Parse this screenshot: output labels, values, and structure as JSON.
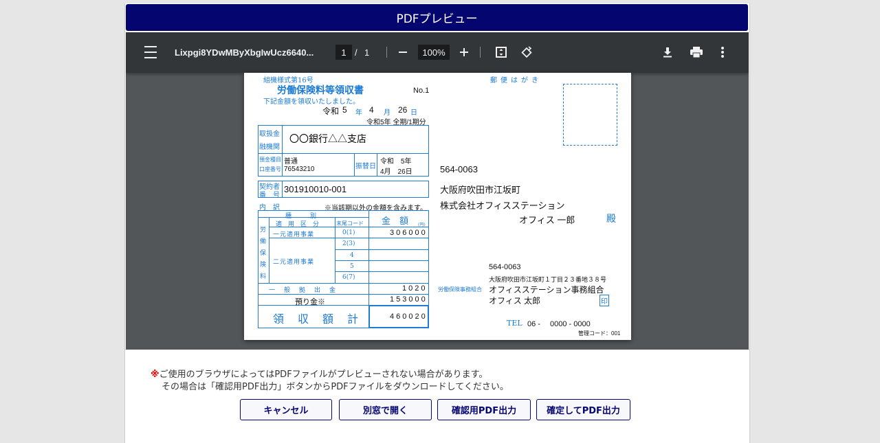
{
  "dialog": {
    "title": "PDFプレビュー"
  },
  "viewer": {
    "file_name": "Lixpgi8YDwMByXbgIwUcz6640...",
    "current_page": "1",
    "page_separator": "/",
    "total_pages": "1",
    "zoom": "100%",
    "icons": [
      "menu-icon",
      "zoom-out-icon",
      "zoom-in-icon",
      "fit-page-icon",
      "rotate-icon",
      "download-icon",
      "print-icon",
      "more-vert-icon"
    ]
  },
  "document": {
    "form_number": "組機様式第16号",
    "title": "労働保険料等領収書",
    "no": "No.1",
    "received_text": "下記金額を領収いたしました。",
    "date": {
      "era": "令和",
      "year": "5",
      "year_unit": "年",
      "month": "4",
      "month_unit": "月",
      "day": "26",
      "day_unit": "日"
    },
    "period": "令和5年 全期/1期分",
    "bank_label_1": "取扱金",
    "bank_label_2": "融機関",
    "bank_name": "〇〇銀行△△支店",
    "account_label_1": "預金種目",
    "account_label_2": "口座番号",
    "account_type": "普通",
    "account_number": "76543210",
    "transfer_label": "振替日",
    "transfer_date_1": "令和　5年",
    "transfer_date_2": "4月　26日",
    "contract_label_1": "契約者",
    "contract_label_2": "番　号",
    "contract_number": "301910010-001",
    "breakdown_label": "内　訳",
    "breakdown_note": "※当該期以外の金額を含みます。",
    "table": {
      "kind_header": "種　　　別",
      "category_header": "適　用　区　分",
      "code_header": "末尾コード",
      "amount_header": "金　額",
      "yen": "(円)",
      "side_label": [
        "労",
        "働",
        "保",
        "険",
        "料"
      ],
      "rows": [
        {
          "category": "一元適用事業",
          "code": "0(1)",
          "amount": "306000"
        },
        {
          "category": "",
          "code": "2(3)",
          "amount": ""
        },
        {
          "category": "二元適用事業",
          "code": "4",
          "amount": ""
        },
        {
          "category": "",
          "code": "5",
          "amount": ""
        },
        {
          "category": "",
          "code": "6(7)",
          "amount": ""
        }
      ],
      "general_label": "一　般　拠　出　金",
      "general_amount": "1020",
      "deposit_label": "預り金※",
      "deposit_amount": "153000",
      "total_label": "領　収　額　計",
      "total_amount": "460020"
    },
    "postcard_label": "郵便はがき",
    "recipient": {
      "zip": "564-0063",
      "address": "大阪府吹田市江坂町",
      "company": "株式会社オフィスステーション",
      "name": "オフィス 一郎",
      "honorific": "殿"
    },
    "sender": {
      "zip": "564-0063",
      "address": "大阪府吹田市江坂町１丁目２３番地３８号",
      "label": "労働保険事務組合",
      "org": "オフィスステーション事務組合",
      "name": "オフィス 太郎",
      "seal": "印",
      "tel_label": "TEL",
      "tel": "06 -　 0000 - 0000"
    },
    "management_code": "管理コード：001"
  },
  "notes": {
    "mark": "※",
    "line1": "ご使用のブラウザによってはPDFファイルがプレビューされない場合があります。",
    "line2": "その場合は「確認用PDF出力」ボタンからPDFファイルをダウンロードしてください。"
  },
  "buttons": {
    "cancel": "キャンセル",
    "open_window": "別窓で開く",
    "confirm_pdf": "確認用PDF出力",
    "finalize_pdf": "確定してPDF出力"
  }
}
